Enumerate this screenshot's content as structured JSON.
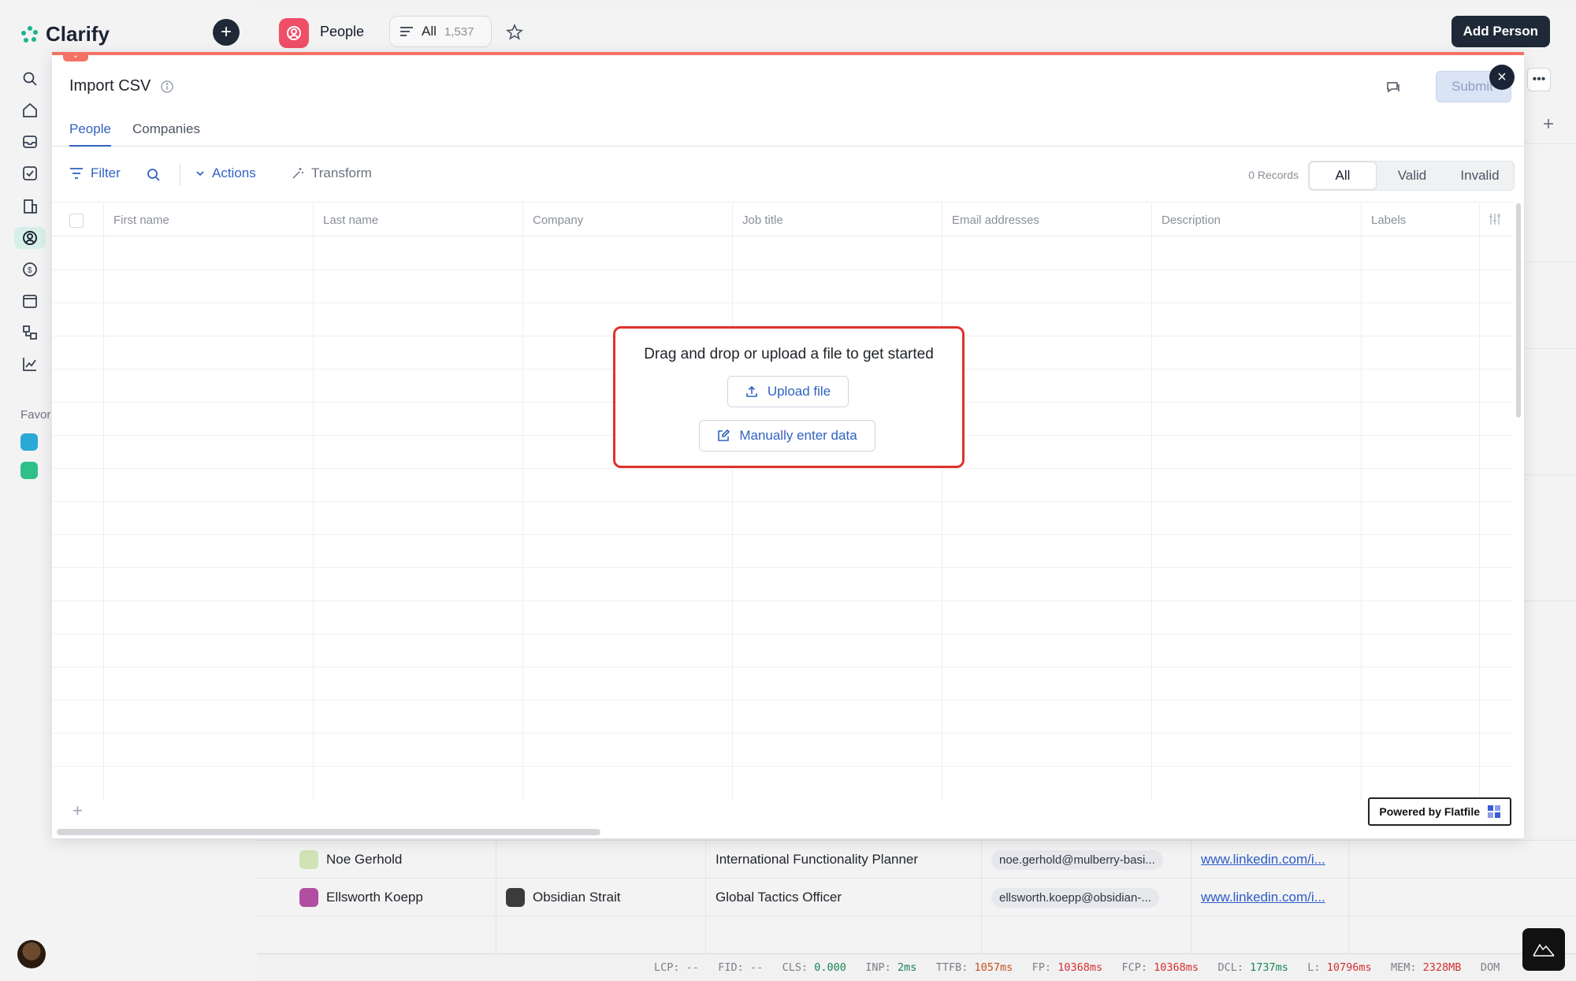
{
  "app": {
    "name": "Clarify"
  },
  "topbar": {
    "object_title": "People",
    "view_name": "All",
    "view_count": "1,537",
    "add_button": "Add Person"
  },
  "sidebar": {
    "favorites_label": "Favor",
    "nav_icons": [
      "search-icon",
      "home-icon",
      "inbox-icon",
      "tasks-icon",
      "companies-icon",
      "people-icon",
      "deals-icon",
      "calendar-icon",
      "workflows-icon",
      "reports-icon"
    ]
  },
  "modal": {
    "title": "Import CSV",
    "submit_label": "Submit",
    "tabs": [
      {
        "label": "People",
        "active": true
      },
      {
        "label": "Companies",
        "active": false
      }
    ],
    "toolbar": {
      "filter": "Filter",
      "actions": "Actions",
      "transform": "Transform",
      "records": "0 Records",
      "segments": [
        "All",
        "Valid",
        "Invalid"
      ],
      "active_segment": "All"
    },
    "columns": [
      "First name",
      "Last name",
      "Company",
      "Job title",
      "Email addresses",
      "Description",
      "Labels"
    ],
    "dropzone": {
      "text": "Drag and drop or upload a file to get started",
      "upload": "Upload file",
      "manual": "Manually enter data"
    },
    "powered_by": "Powered by Flatfile"
  },
  "background_rows": [
    {
      "name": "Noe Gerhold",
      "company": "",
      "job": "International Functionality Planner",
      "email": "noe.gerhold@mulberry-basi...",
      "linkedin": "www.linkedin.com/i..."
    },
    {
      "name": "Ellsworth Koepp",
      "company": "Obsidian Strait",
      "job": "Global Tactics Officer",
      "email": "ellsworth.koepp@obsidian-...",
      "linkedin": "www.linkedin.com/i..."
    }
  ],
  "perf": {
    "lcp": "LCP: --",
    "fid": "FID: --",
    "cls_label": "CLS:",
    "cls": "0.000",
    "inp_label": "INP:",
    "inp": "2ms",
    "ttfb_label": "TTFB:",
    "ttfb": "1057ms",
    "fp_label": "FP:",
    "fp": "10368ms",
    "fcp_label": "FCP:",
    "fcp": "10368ms",
    "dcl_label": "DCL:",
    "dcl": "1737ms",
    "l_label": "L:",
    "l": "10796ms",
    "mem_label": "MEM:",
    "mem": "2328MB",
    "dom": "DOM"
  },
  "colors": {
    "brand_teal": "#19b48f",
    "accent_blue": "#3163c2",
    "modal_top": "#f37264",
    "highlight_red": "#e0312b",
    "people_icon_bg": "#ef4e67"
  }
}
